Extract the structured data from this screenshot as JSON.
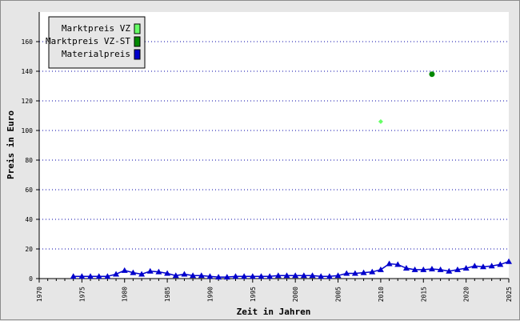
{
  "chart_data": {
    "type": "line",
    "xlabel": "Zeit in Jahren",
    "ylabel": "Preis in Euro",
    "xlim": [
      1970,
      2025
    ],
    "ylim": [
      0,
      180
    ],
    "x_ticks": [
      1970,
      1975,
      1980,
      1985,
      1990,
      1995,
      2000,
      2005,
      2010,
      2015,
      2020,
      2025
    ],
    "y_ticks": [
      0,
      20,
      40,
      60,
      80,
      100,
      120,
      140,
      160
    ],
    "grid": "horizontal dotted",
    "legend_position": "top-left",
    "series": [
      {
        "name": "Marktpreis VZ",
        "color": "#66ff66",
        "marker": "diamond",
        "line": false,
        "x": [
          2010
        ],
        "y": [
          106
        ]
      },
      {
        "name": "Marktpreis VZ-ST",
        "color": "#008800",
        "marker": "circle",
        "line": false,
        "x": [
          2016
        ],
        "y": [
          138
        ]
      },
      {
        "name": "Materialpreis",
        "color": "#0000cc",
        "marker": "triangle",
        "line": true,
        "x": [
          1974,
          1975,
          1976,
          1977,
          1978,
          1979,
          1980,
          1981,
          1982,
          1983,
          1984,
          1985,
          1986,
          1987,
          1988,
          1989,
          1990,
          1991,
          1992,
          1993,
          1994,
          1995,
          1996,
          1997,
          1998,
          1999,
          2000,
          2001,
          2002,
          2003,
          2004,
          2005,
          2006,
          2007,
          2008,
          2009,
          2010,
          2011,
          2012,
          2013,
          2014,
          2015,
          2016,
          2017,
          2018,
          2019,
          2020,
          2021,
          2022,
          2023,
          2024,
          2025
        ],
        "y": [
          1.5,
          1.5,
          1.5,
          1.5,
          1.5,
          3,
          5.5,
          4,
          3,
          5,
          4.5,
          3.5,
          2,
          3,
          2,
          2,
          1.5,
          1,
          1,
          1.5,
          1.5,
          1.5,
          1.5,
          1.5,
          2,
          2,
          2,
          2,
          2,
          1.5,
          1.5,
          2,
          3.5,
          3.5,
          4,
          4.5,
          6,
          10,
          9.5,
          7,
          6,
          6,
          6.5,
          6,
          5,
          6,
          7,
          8.5,
          8,
          8.5,
          9.5,
          11.5
        ]
      }
    ]
  }
}
